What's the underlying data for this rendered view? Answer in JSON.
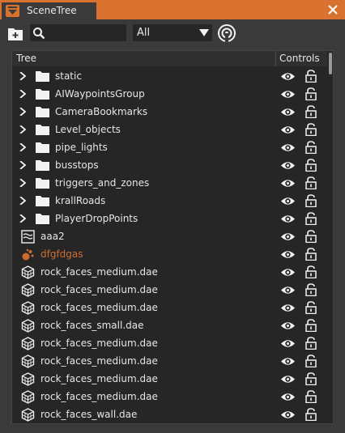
{
  "window": {
    "tab_label": "SceneTree",
    "accent_color": "#d9722f"
  },
  "toolbar": {
    "search_value": "",
    "filter_selected": "All"
  },
  "tree": {
    "column_tree": "Tree",
    "column_controls": "Controls",
    "rows": [
      {
        "label": "static",
        "type": "folder"
      },
      {
        "label": "AIWaypointsGroup",
        "type": "folder"
      },
      {
        "label": "CameraBookmarks",
        "type": "folder"
      },
      {
        "label": "Level_objects",
        "type": "folder"
      },
      {
        "label": "pipe_lights",
        "type": "folder"
      },
      {
        "label": "busstops",
        "type": "folder"
      },
      {
        "label": "triggers_and_zones",
        "type": "folder"
      },
      {
        "label": "krallRoads",
        "type": "folder"
      },
      {
        "label": "PlayerDropPoints",
        "type": "folder"
      },
      {
        "label": "aaa2",
        "type": "water-icon"
      },
      {
        "label": "dfgfdgas",
        "type": "particle-icon"
      },
      {
        "label": "rock_faces_medium.dae",
        "type": "mesh-icon"
      },
      {
        "label": "rock_faces_medium.dae",
        "type": "mesh-icon"
      },
      {
        "label": "rock_faces_medium.dae",
        "type": "mesh-icon"
      },
      {
        "label": "rock_faces_small.dae",
        "type": "mesh-icon"
      },
      {
        "label": "rock_faces_medium.dae",
        "type": "mesh-icon"
      },
      {
        "label": "rock_faces_medium.dae",
        "type": "mesh-icon"
      },
      {
        "label": "rock_faces_medium.dae",
        "type": "mesh-icon"
      },
      {
        "label": "rock_faces_medium.dae",
        "type": "mesh-icon"
      },
      {
        "label": "rock_faces_wall.dae",
        "type": "mesh-icon"
      }
    ]
  }
}
